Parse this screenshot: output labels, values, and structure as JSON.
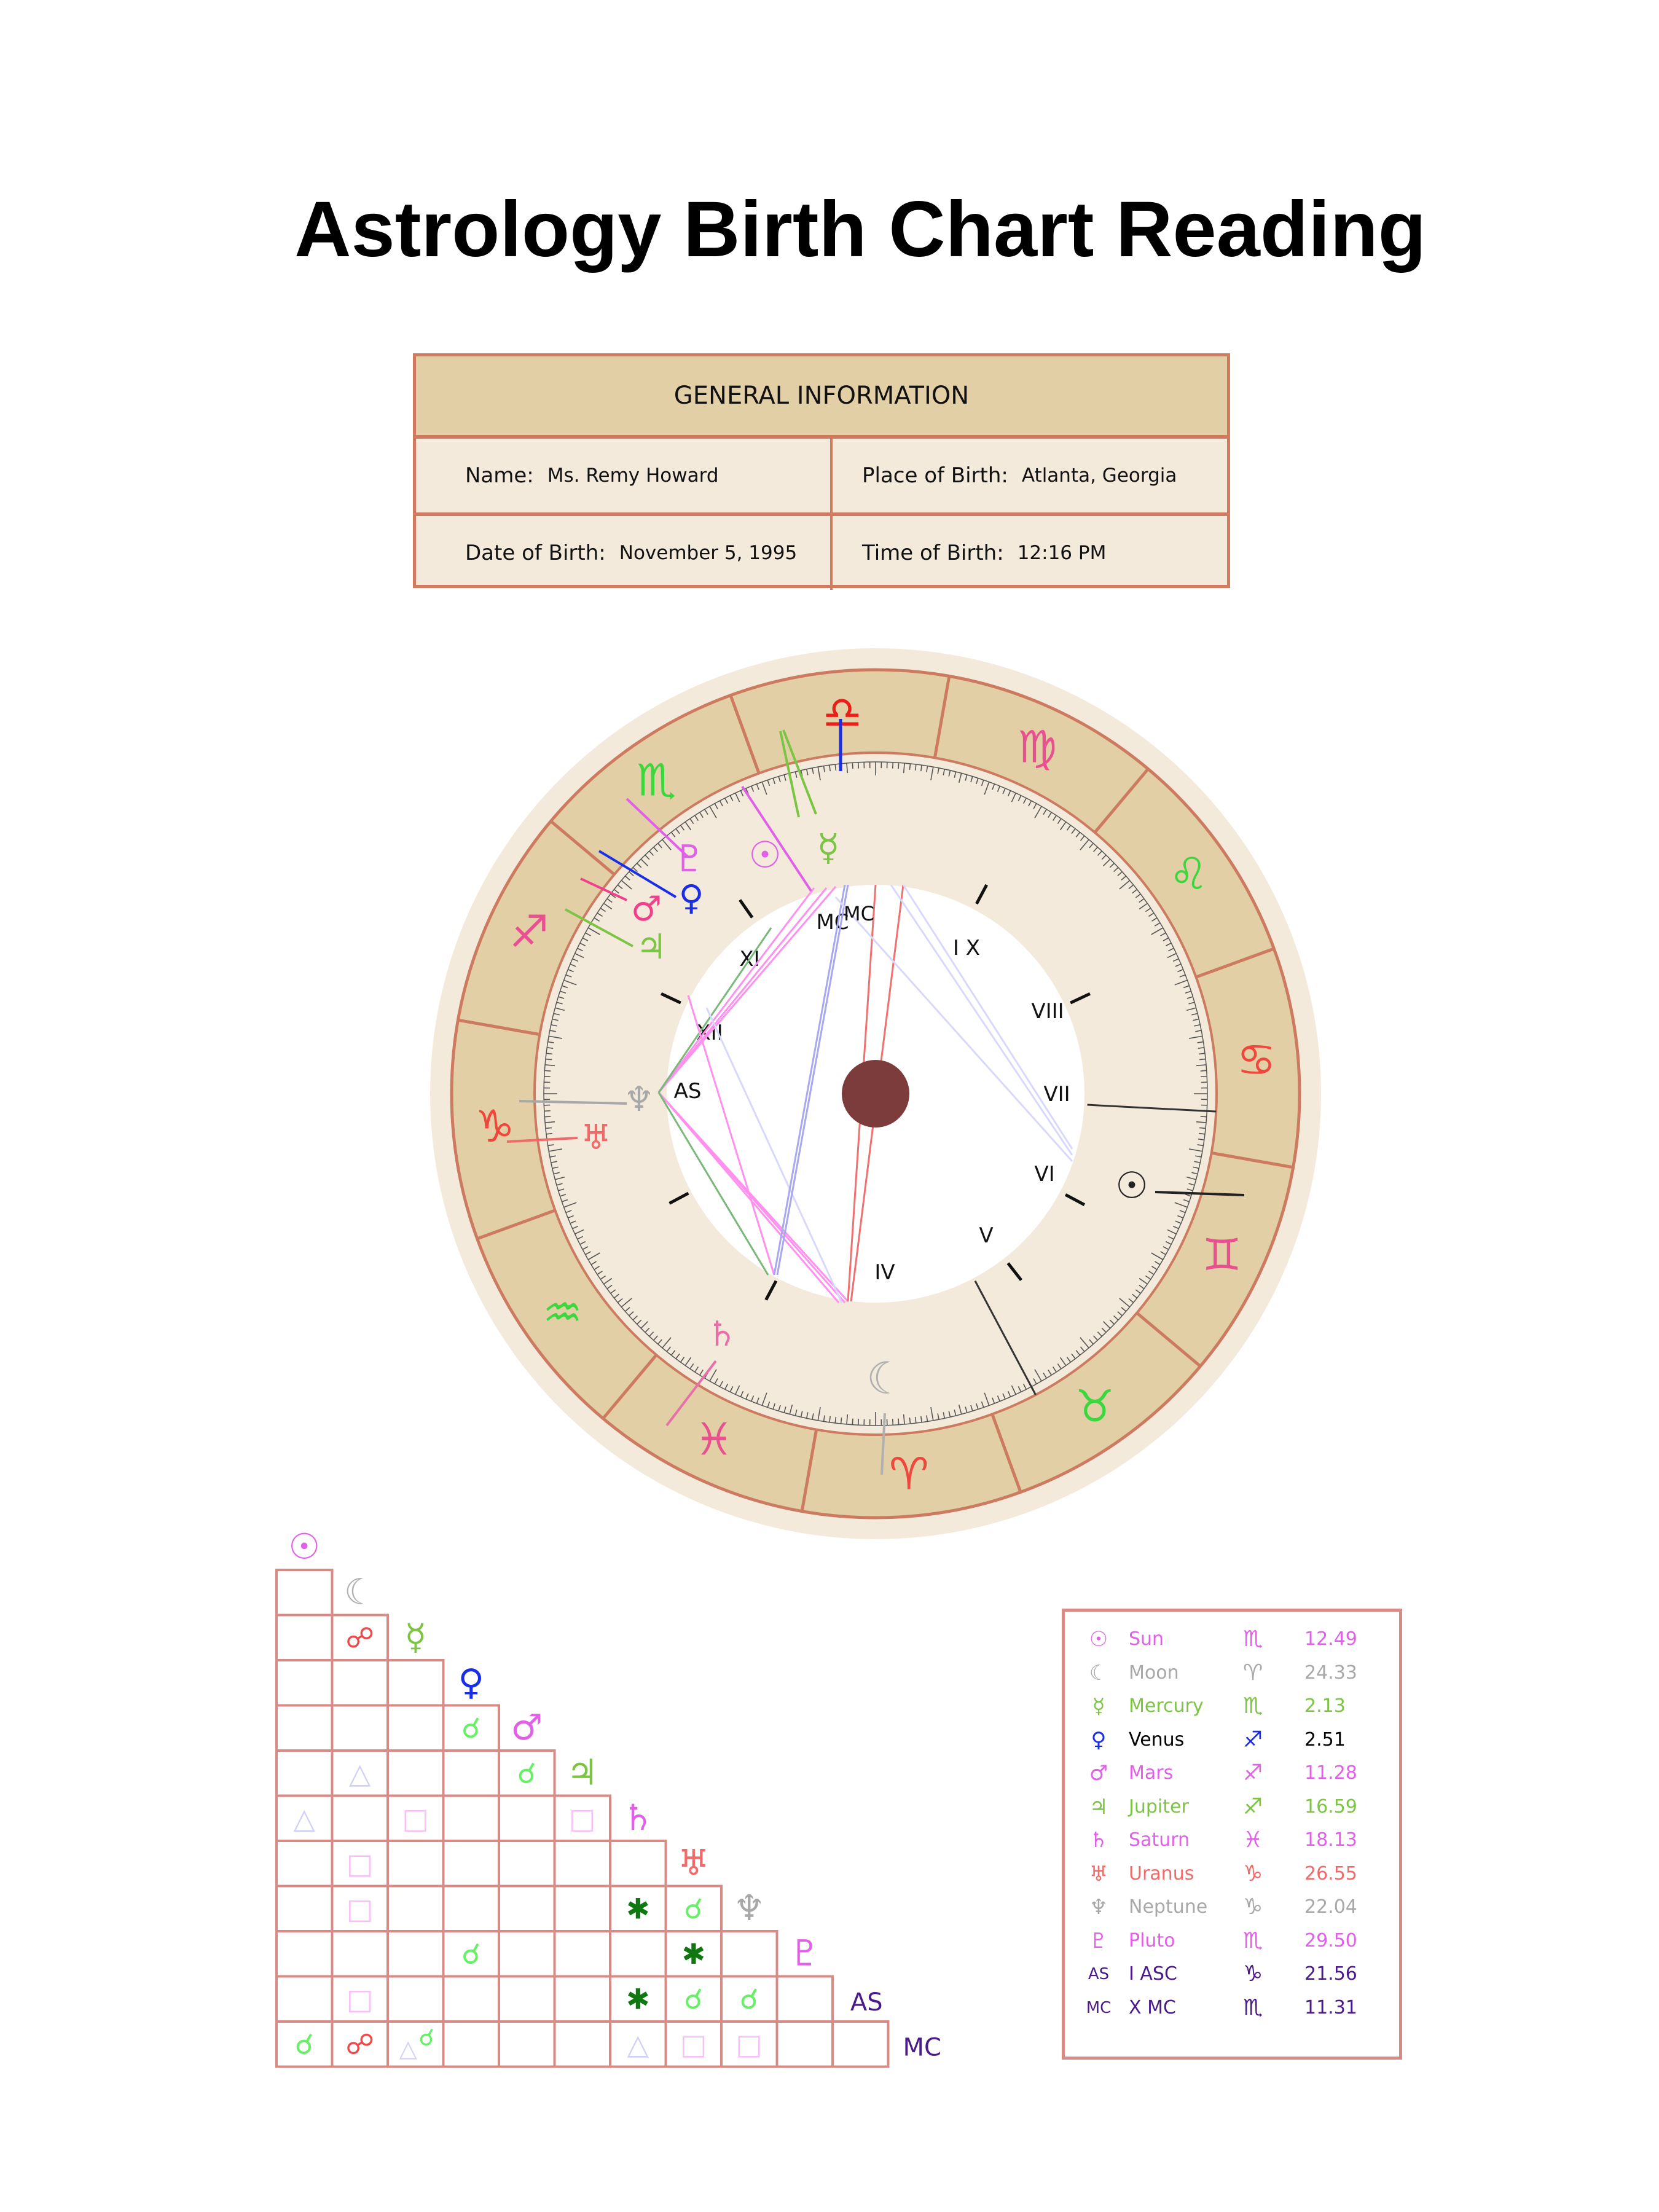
{
  "title": "Astrology Birth Chart Reading",
  "general_info": {
    "header": "GENERAL INFORMATION",
    "name_label": "Name:",
    "name": "Ms. Remy Howard",
    "place_label": "Place of Birth:",
    "place": "Atlanta, Georgia",
    "date_label": "Date of Birth:",
    "date": "November 5, 1995",
    "time_label": "Time of Birth:",
    "time": "12:16 PM"
  },
  "colors": {
    "border": "#d07a60",
    "header_bg": "#e3cfa6",
    "cell_bg": "#f3eadb",
    "center_dot": "#7d3c3c"
  },
  "wheel": {
    "signs": [
      {
        "name": "libra",
        "glyph": "♎",
        "color": "#e8201a"
      },
      {
        "name": "virgo",
        "glyph": "♍",
        "color": "#e8508f"
      },
      {
        "name": "leo",
        "glyph": "♌",
        "color": "#3ed63e"
      },
      {
        "name": "cancer",
        "glyph": "♋",
        "color": "#f0463c"
      },
      {
        "name": "gemini",
        "glyph": "♊",
        "color": "#e8508f"
      },
      {
        "name": "taurus",
        "glyph": "♉",
        "color": "#3ed63e"
      },
      {
        "name": "aries",
        "glyph": "♈",
        "color": "#f0463c"
      },
      {
        "name": "pisces",
        "glyph": "♓",
        "color": "#e8508f"
      },
      {
        "name": "aquarius",
        "glyph": "♒",
        "color": "#3ed63e"
      },
      {
        "name": "capricorn",
        "glyph": "♑",
        "color": "#f0463c"
      },
      {
        "name": "sagittarius",
        "glyph": "♐",
        "color": "#e8508f"
      },
      {
        "name": "scorpio",
        "glyph": "♏",
        "color": "#3ed63e"
      }
    ],
    "houses": [
      "AS",
      "XII",
      "XI",
      "MC",
      "I X",
      "VIII",
      "VII",
      "VI",
      "V",
      "IV"
    ],
    "planets": [
      {
        "name": "sun",
        "glyph": "☉",
        "color": "#e060e8"
      },
      {
        "name": "mercury",
        "glyph": "☿",
        "color": "#7cc444"
      },
      {
        "name": "pluto",
        "glyph": "♇",
        "color": "#e060e8"
      },
      {
        "name": "venus",
        "glyph": "♀",
        "color": "#1a2ee8"
      },
      {
        "name": "mars",
        "glyph": "♂",
        "color": "#f0408c"
      },
      {
        "name": "jupiter",
        "glyph": "♃",
        "color": "#7cc444"
      },
      {
        "name": "neptune",
        "glyph": "♆",
        "color": "#a8a8a8"
      },
      {
        "name": "uranus",
        "glyph": "♅",
        "color": "#f06a6a"
      },
      {
        "name": "saturn",
        "glyph": "♄",
        "color": "#e870a8"
      },
      {
        "name": "moon",
        "glyph": "☾",
        "color": "#b0b0b0"
      },
      {
        "name": "sun-opposite",
        "glyph": "☉",
        "color": "#222222"
      }
    ]
  },
  "aspect_grid": {
    "bodies": [
      {
        "glyph": "☉",
        "color": "#e060e8"
      },
      {
        "glyph": "☾",
        "color": "#b0b0b0"
      },
      {
        "glyph": "☿",
        "color": "#7cc444"
      },
      {
        "glyph": "♀",
        "color": "#1a2ee8"
      },
      {
        "glyph": "♂",
        "color": "#e060e8"
      },
      {
        "glyph": "♃",
        "color": "#7cc444"
      },
      {
        "glyph": "♄",
        "color": "#e060e8"
      },
      {
        "glyph": "♅",
        "color": "#f06a6a"
      },
      {
        "glyph": "♆",
        "color": "#a8a8a8"
      },
      {
        "glyph": "♇",
        "color": "#e060e8"
      },
      {
        "glyph": "AS",
        "color": "#4a1a8a"
      },
      {
        "glyph": "MC",
        "color": "#4a1a8a"
      }
    ],
    "aspects": [
      {
        "row": 2,
        "col": 1,
        "type": "opposition"
      },
      {
        "row": 4,
        "col": 3,
        "type": "conjunction"
      },
      {
        "row": 5,
        "col": 1,
        "type": "trine"
      },
      {
        "row": 5,
        "col": 4,
        "type": "conjunction"
      },
      {
        "row": 6,
        "col": 0,
        "type": "trine"
      },
      {
        "row": 6,
        "col": 2,
        "type": "square"
      },
      {
        "row": 6,
        "col": 5,
        "type": "square"
      },
      {
        "row": 7,
        "col": 1,
        "type": "square"
      },
      {
        "row": 8,
        "col": 1,
        "type": "square"
      },
      {
        "row": 8,
        "col": 6,
        "type": "sextile"
      },
      {
        "row": 8,
        "col": 7,
        "type": "conjunction"
      },
      {
        "row": 9,
        "col": 3,
        "type": "conjunction"
      },
      {
        "row": 9,
        "col": 7,
        "type": "sextile"
      },
      {
        "row": 10,
        "col": 1,
        "type": "square"
      },
      {
        "row": 10,
        "col": 6,
        "type": "sextile"
      },
      {
        "row": 10,
        "col": 7,
        "type": "conjunction"
      },
      {
        "row": 10,
        "col": 8,
        "type": "conjunction"
      },
      {
        "row": 11,
        "col": 0,
        "type": "conjunction"
      },
      {
        "row": 11,
        "col": 1,
        "type": "opposition"
      },
      {
        "row": 11,
        "col": 2,
        "type": "trine-conjunction"
      },
      {
        "row": 11,
        "col": 6,
        "type": "trine"
      },
      {
        "row": 11,
        "col": 7,
        "type": "square"
      },
      {
        "row": 11,
        "col": 8,
        "type": "square"
      }
    ],
    "aspect_styles": {
      "conjunction": {
        "glyph": "☌",
        "color": "#66f066"
      },
      "opposition": {
        "glyph": "☍",
        "color": "#f04848"
      },
      "trine": {
        "glyph": "△",
        "color": "#d0d0f8"
      },
      "square": {
        "glyph": "□",
        "color": "#f8c0f8"
      },
      "sextile": {
        "glyph": "✱",
        "color": "#107810"
      }
    }
  },
  "legend": [
    {
      "glyph": "☉",
      "name": "Sun",
      "sign": "♏",
      "degree": "12.49",
      "color": "#e060e8",
      "sign_color": "#e060e8"
    },
    {
      "glyph": "☾",
      "name": "Moon",
      "sign": "♈",
      "degree": "24.33",
      "color": "#a8a8a8",
      "sign_color": "#a8a8a8"
    },
    {
      "glyph": "☿",
      "name": "Mercury",
      "sign": "♏",
      "degree": "2.13",
      "color": "#7cc444",
      "sign_color": "#7cc444"
    },
    {
      "glyph": "♀",
      "name": "Venus",
      "sign": "♐",
      "degree": "2.51",
      "color": "#000000",
      "glyph_color": "#1a2ee8",
      "sign_color": "#1a2ee8"
    },
    {
      "glyph": "♂",
      "name": "Mars",
      "sign": "♐",
      "degree": "11.28",
      "color": "#e060e8",
      "sign_color": "#e060e8"
    },
    {
      "glyph": "♃",
      "name": "Jupiter",
      "sign": "♐",
      "degree": "16.59",
      "color": "#7cc444",
      "sign_color": "#7cc444"
    },
    {
      "glyph": "♄",
      "name": "Saturn",
      "sign": "♓",
      "degree": "18.13",
      "color": "#e060e8",
      "sign_color": "#e060e8"
    },
    {
      "glyph": "♅",
      "name": "Uranus",
      "sign": "♑",
      "degree": "26.55",
      "color": "#f06a6a",
      "sign_color": "#f06a6a"
    },
    {
      "glyph": "♆",
      "name": "Neptune",
      "sign": "♑",
      "degree": "22.04",
      "color": "#a8a8a8",
      "sign_color": "#a8a8a8"
    },
    {
      "glyph": "♇",
      "name": "Pluto",
      "sign": "♏",
      "degree": "29.50",
      "color": "#e060e8",
      "sign_color": "#e060e8"
    },
    {
      "glyph": "AS",
      "name": "I ASC",
      "sign": "♑",
      "degree": "21.56",
      "color": "#4a1a8a",
      "sign_color": "#4a1a8a"
    },
    {
      "glyph": "MC",
      "name": "X MC",
      "sign": "♏",
      "degree": "11.31",
      "color": "#4a1a8a",
      "sign_color": "#4a1a8a"
    }
  ]
}
